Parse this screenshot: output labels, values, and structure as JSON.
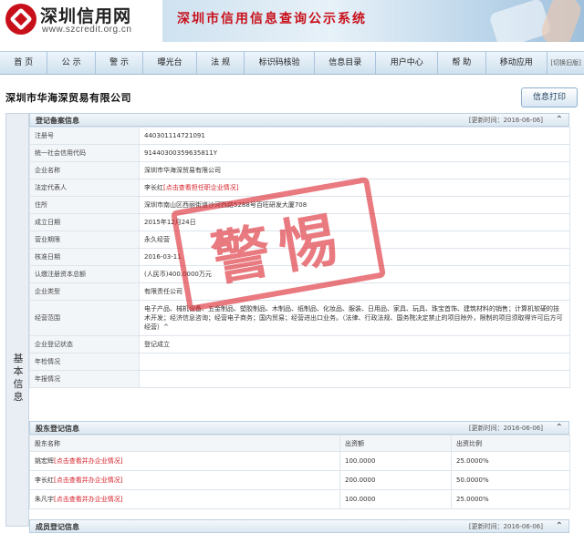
{
  "header": {
    "brand": "深圳信用网",
    "url": "www.szcredit.org.cn",
    "banner_title": "深圳市信用信息查询公示系统"
  },
  "nav": {
    "items": [
      "首 页",
      "公 示",
      "警 示",
      "曝光台",
      "法 规",
      "标识码核验",
      "信息目录",
      "用户中心",
      "帮 助",
      "移动应用"
    ],
    "switch": "[切换旧版]"
  },
  "company": {
    "name": "深圳市华海深贸易有限公司",
    "print_label": "信息打印"
  },
  "side_label": "基本信息",
  "registration": {
    "title": "登记备案信息",
    "updated": "[更新时间：2016-06-06]",
    "rows": [
      {
        "label": "注册号",
        "value": "440301114721091"
      },
      {
        "label": "统一社会信用代码",
        "value": "91440300359635811Y"
      },
      {
        "label": "企业名称",
        "value": "深圳市华海深贸易有限公司"
      },
      {
        "label": "法定代表人",
        "value": "李长红",
        "link": "[点击查看担任职企业情况]"
      },
      {
        "label": "住所",
        "value": "深圳市南山区西丽街道沙河西路5288号百旺研发大厦708"
      },
      {
        "label": "成立日期",
        "value": "2015年12月24日"
      },
      {
        "label": "营业期限",
        "value": "永久经营"
      },
      {
        "label": "核准日期",
        "value": "2016-03-11"
      },
      {
        "label": "认缴注册资本总额",
        "value": "(人民币)400.0000万元"
      },
      {
        "label": "企业类型",
        "value": "有限责任公司"
      },
      {
        "label": "经营范围",
        "value": "电子产品、械机设备、五金制品、塑胶制品、木制品、纸制品、化妆品、服装、日用品、家具、玩具、珠宝首饰、建筑材料的销售；计算机软硬的技术开发；经济信息咨询；经营电子商务；国内贸易；经营进出口业务。（法律、行政法规、国务院决定禁止的项目除外，限制的项目须取得许可后方可经营）^"
      },
      {
        "label": "企业登记状态",
        "value": "登记成立"
      },
      {
        "label": "年检情况",
        "value": ""
      },
      {
        "label": "年报情况",
        "value": ""
      }
    ]
  },
  "shareholders": {
    "title": "股东登记信息",
    "updated": "[更新时间：2016-06-06]",
    "headers": [
      "股东名称",
      "出资额",
      "出资比例"
    ],
    "rows": [
      {
        "name": "姚宏辉",
        "link": "[点击查看并办企业情况]",
        "amount": "100.0000",
        "ratio": "25.0000%"
      },
      {
        "name": "李长红",
        "link": "[点击查看并办企业情况]",
        "amount": "200.0000",
        "ratio": "50.0000%"
      },
      {
        "name": "朱凡宇",
        "link": "[点击查看并办企业情况]",
        "amount": "100.0000",
        "ratio": "25.0000%"
      }
    ]
  },
  "members": {
    "title": "成员登记信息",
    "updated": "[更新时间：2016-06-06]"
  },
  "stamp": "警惕",
  "colors": {
    "accent_red": "#c8101a",
    "link_red": "#d6202a",
    "nav_bg": "#cfe1ef"
  }
}
